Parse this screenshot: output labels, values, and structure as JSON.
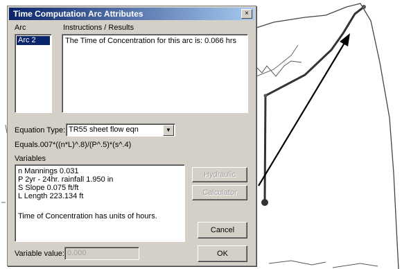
{
  "dialog": {
    "title": "Time Computation Arc Attributes",
    "close": "×",
    "arc_label": "Arc",
    "arc_items": [
      "Arc 2"
    ],
    "instructions_label": "Instructions / Results",
    "result_text": "The Time of Concentration for this arc is:  0.066  hrs",
    "equation_type_label": "Equation Type:",
    "equation_type_value": "TR55 sheet flow eqn",
    "equation_text": "Equals.007*((n*L)^.8)/(P^.5)*(s^.4)",
    "variables_label": "Variables",
    "variables": [
      "n  Mannings  0.031",
      "P  2yr - 24hr. rainfall  1.950  in",
      "S  Slope  0.075  ft/ft",
      "L  Length  223.134  ft"
    ],
    "units_text": "Time of Concentration has units of hours.",
    "hydraulic_button": "Hydraulic Radius",
    "calculator_button": "Calculator",
    "cancel_button": "Cancel",
    "ok_button": "OK",
    "variable_value_label": "Variable value:",
    "variable_value": "0.000"
  },
  "colors": {
    "dialog_bg": "#d4d0c8",
    "titlebar": "#0a246a",
    "selection": "#0a246a",
    "flow_path": "#333333"
  }
}
